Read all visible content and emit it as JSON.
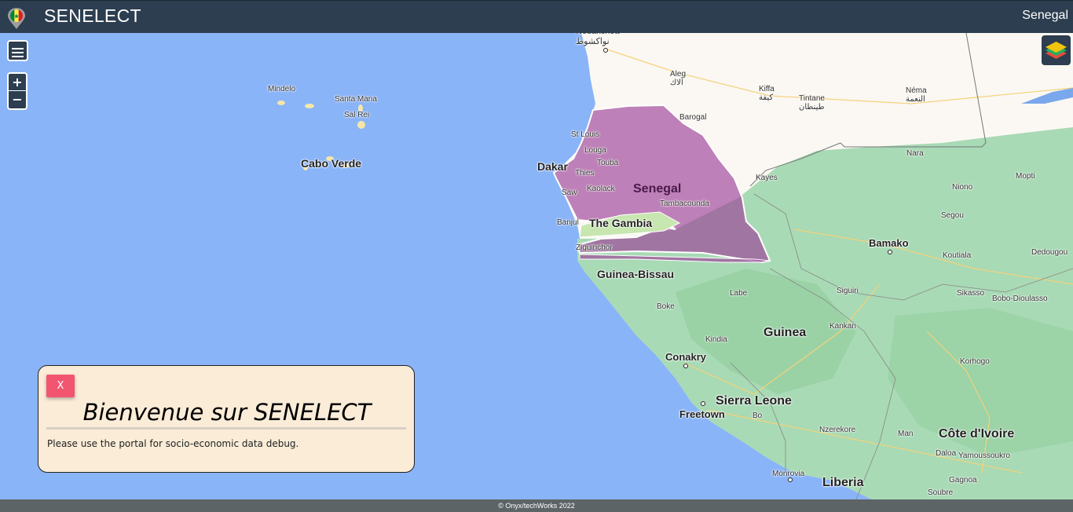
{
  "header": {
    "title": "SENELECT",
    "country": "Senegal"
  },
  "controls": {
    "zoom_in": "+",
    "zoom_out": "−"
  },
  "map": {
    "country_label": "Senegal",
    "places": {
      "nouakchott": "Nouakchott\nنواكشوط",
      "aleg": "Aleg\nألاك",
      "kiffa": "Kiffa\nكيفة",
      "tintane": "Tintane\nطينطان",
      "nema": "Néma\nالنعمة",
      "barogal": "Barogal",
      "nara": "Nara",
      "mindelo": "Mindelo",
      "santa_maria": "Santa Maria",
      "sal_rei": "Sal Rei",
      "cabo_verde": "Cabo Verde",
      "st_louis": "St Louis",
      "louga": "Louga",
      "dakar": "Dakar",
      "thies": "Thies",
      "touba": "Touba",
      "kaolack": "Kaolack",
      "saw": "Saw",
      "kayes": "Kayes",
      "niono": "Niono",
      "mopti": "Mopti",
      "segou": "Segou",
      "tambacounda": "Tambacounda",
      "banjul": "Banjul",
      "the_gambia": "The Gambia",
      "ziguinchor": "Ziguinchor",
      "guinea_bissau": "Guinea-Bissau",
      "bamako": "Bamako",
      "koutiala": "Koutiala",
      "dedougou": "Dedougou",
      "boke": "Boke",
      "labe": "Labe",
      "siguiri": "Siguiri",
      "sikasso": "Sikasso",
      "bobo": "Bobo-Dioulasso",
      "guinea": "Guinea",
      "kankan": "Kankan",
      "kindia": "Kindia",
      "conakry": "Conakry",
      "korhogo": "Korhogo",
      "sierra_leone": "Sierra Leone",
      "freetown": "Freetown",
      "bo": "Bo",
      "nzerekore": "Nzerekore",
      "man": "Man",
      "cote_divoire": "Côte d'Ivoire",
      "daloa": "Daloa",
      "yamoussoukro": "Yamoussoukro",
      "monrovia": "Monrovia",
      "liberia": "Liberia",
      "gagnoa": "Gagnoa",
      "soubre": "Soubre"
    },
    "colors": {
      "ocean": "#8ab4f8",
      "land": "#fbf8f3",
      "green": "#a8dab5",
      "highlight": "#9c3f98"
    }
  },
  "welcome": {
    "close_label": "X",
    "title": "Bienvenue sur SENELECT",
    "message": "Please use the portal for socio-economic data debug."
  },
  "footer": {
    "copyright": "© Onyx/techWorks 2022"
  }
}
